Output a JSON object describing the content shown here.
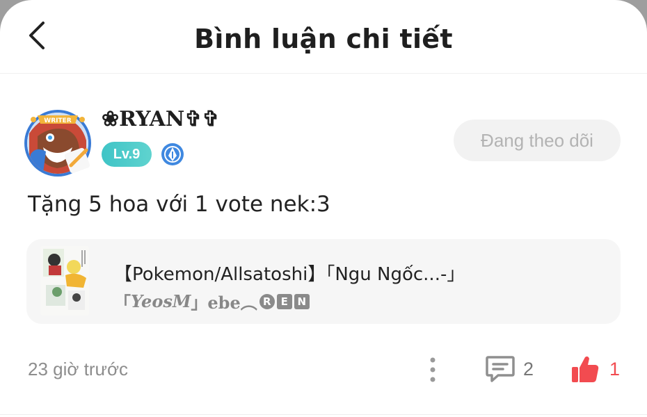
{
  "header": {
    "title": "Bình luận chi tiết",
    "back_icon": "chevron-left-icon"
  },
  "user": {
    "name": "❀RYAN✞✞",
    "level": "Lv.9",
    "avatar_badge": "WRITER",
    "writer_icon": "pen-badge-icon",
    "follow_label": "Đang theo dõi"
  },
  "comment": {
    "text": "Tặng 5 hoa với 1 vote nek:3"
  },
  "story": {
    "title": "【Pokemon/Allsatoshi】「Ngu Ngốc...-」",
    "author_prefix": "「",
    "author_name": "YeosM",
    "author_suffix": "」ebe︵",
    "author_marks": [
      "R",
      "E",
      "N"
    ]
  },
  "footer": {
    "time": "23 giờ trước",
    "reply_count": "2",
    "like_count": "1",
    "like_color": "#f24b50"
  }
}
